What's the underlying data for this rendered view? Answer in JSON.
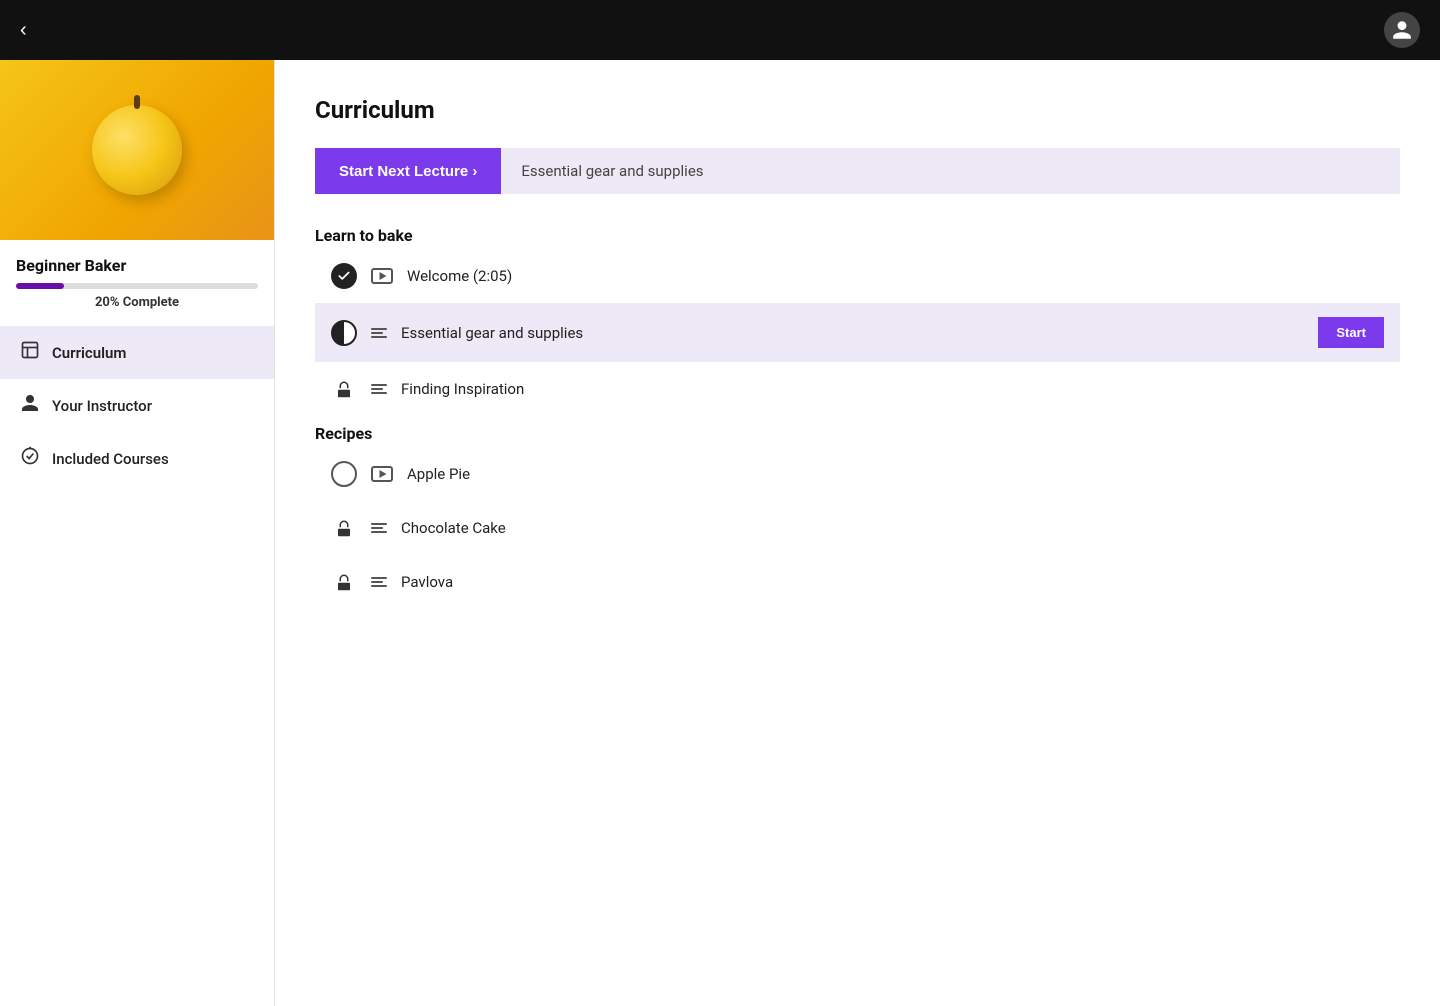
{
  "topbar": {
    "back_label": "‹",
    "avatar_icon": "👤"
  },
  "sidebar": {
    "course_title": "Beginner Baker",
    "progress_percent": 20,
    "progress_label": "20% Complete",
    "nav_items": [
      {
        "id": "curriculum",
        "label": "Curriculum",
        "icon": "curriculum",
        "active": true
      },
      {
        "id": "instructor",
        "label": "Your Instructor",
        "icon": "person",
        "active": false
      },
      {
        "id": "included",
        "label": "Included Courses",
        "icon": "included",
        "active": false
      }
    ]
  },
  "main": {
    "title": "Curriculum",
    "next_lecture_button": "Start Next Lecture  ›",
    "next_lecture_title": "Essential gear and supplies",
    "sections": [
      {
        "id": "learn-to-bake",
        "title": "Learn to bake",
        "lectures": [
          {
            "status": "complete",
            "content_type": "video",
            "title": "Welcome (2:05)",
            "action": null
          },
          {
            "status": "half",
            "content_type": "text",
            "title": "Essential gear and supplies",
            "action": "Start"
          },
          {
            "status": "lock",
            "content_type": "text",
            "title": "Finding Inspiration",
            "action": null
          }
        ]
      },
      {
        "id": "recipes",
        "title": "Recipes",
        "lectures": [
          {
            "status": "empty",
            "content_type": "video",
            "title": "Apple Pie",
            "action": null
          },
          {
            "status": "lock",
            "content_type": "text",
            "title": "Chocolate Cake",
            "action": null
          },
          {
            "status": "lock",
            "content_type": "text",
            "title": "Pavlova",
            "action": null
          }
        ]
      }
    ]
  }
}
